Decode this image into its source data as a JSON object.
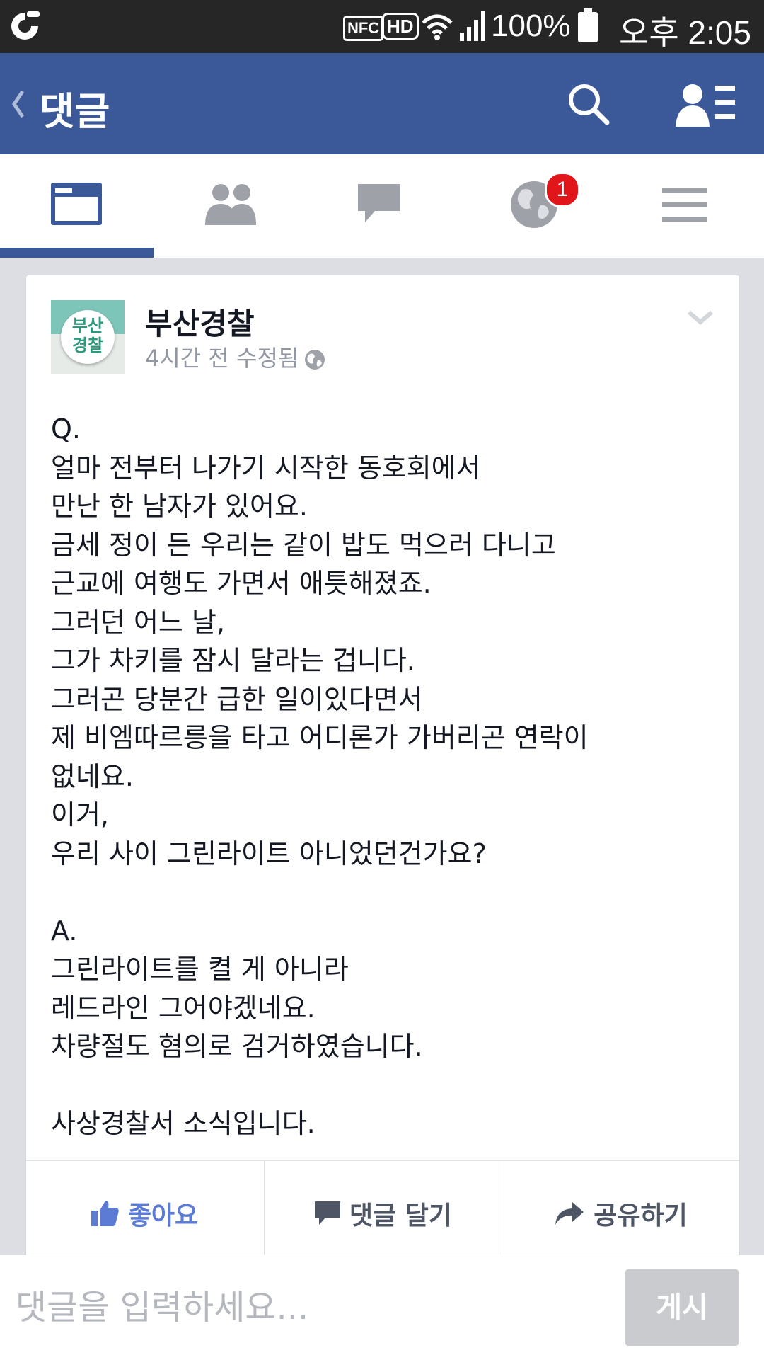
{
  "status_bar": {
    "nfc": "NFC",
    "hd": "HD",
    "battery": "100%",
    "time": "오후 2:05"
  },
  "header": {
    "title": "댓글"
  },
  "tabs": {
    "notification_count": "1",
    "active_index": 0
  },
  "post": {
    "page_name": "부산경찰",
    "avatar_text": "부산\n경찰",
    "meta": "4시간 전 수정됨",
    "body": "Q.\n얼마 전부터 나가기 시작한 동호회에서\n만난 한 남자가 있어요.\n금세 정이 든 우리는 같이 밥도 먹으러 다니고\n근교에 여행도 가면서 애틋해졌죠.\n그러던 어느 날,\n그가 차키를 잠시 달라는 겁니다.\n그러곤 당분간 급한 일이있다면서\n제 비엠따르릉을 타고 어디론가 가버리곤 연락이\n없네요.\n이거,\n우리 사이 그린라이트 아니었던건가요?\n\nA.\n그린라이트를 켤 게 아니라\n레드라인 그어야겠네요.\n차량절도 혐의로 검거하였습니다.\n\n사상경찰서 소식입니다."
  },
  "actions": {
    "like": "좋아요",
    "comment": "댓글 달기",
    "share": "공유하기"
  },
  "comment_box": {
    "placeholder": "댓글을 입력하세요...",
    "value": "",
    "submit": "게시"
  },
  "colors": {
    "brand": "#3b5998",
    "status_bar": "#262626",
    "like_accent": "#5b7bd5",
    "badge": "#e0161b"
  }
}
